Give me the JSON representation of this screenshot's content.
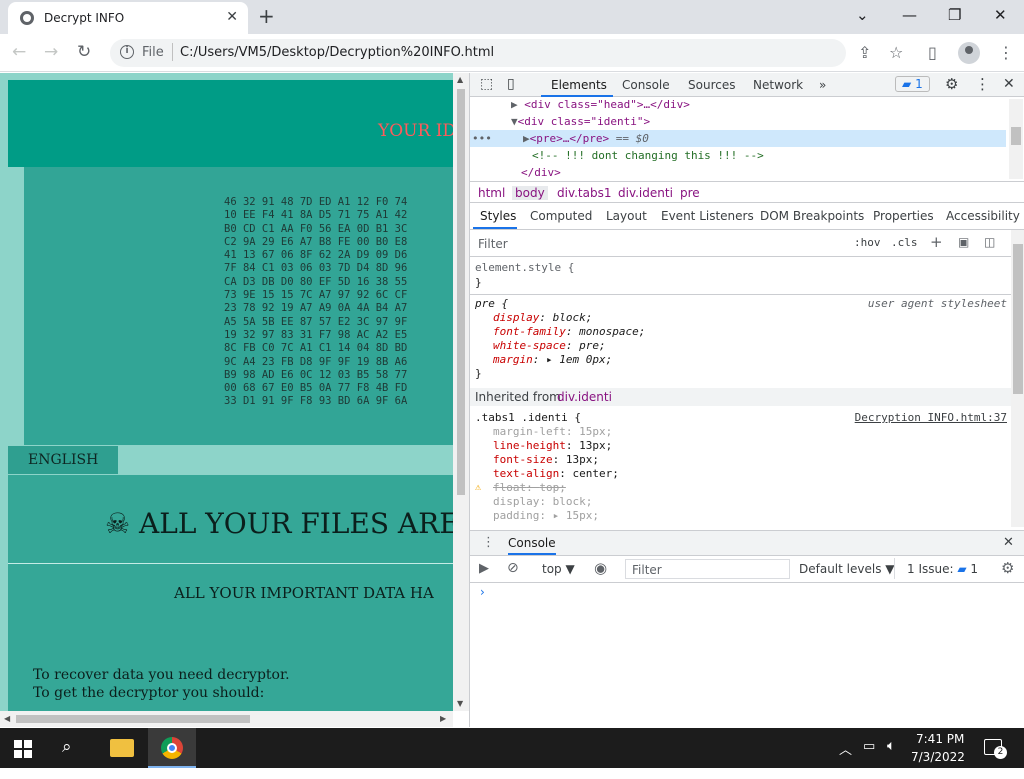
{
  "browser": {
    "tab_title": "Decrypt INFO",
    "new_tab": "+",
    "file_label": "File",
    "url": "C:/Users/VM5/Desktop/Decryption%20INFO.html",
    "controls": {
      "minimize": "⌄",
      "restore": "—",
      "max": "❐",
      "close": "✕"
    }
  },
  "page": {
    "your_id": "YOUR ID",
    "id_lines": [
      "46 32 91 48 7D ED A1 12 F0 74",
      "10 EE F4 41 8A D5 71 75 A1 42",
      "B0 CD C1 AA F0 56 EA 0D B1 3C",
      "C2 9A 29 E6 A7 B8 FE 00 B0 E8",
      "41 13 67 06 8F 62 2A D9 09 D6",
      "7F 84 C1 03 06 03 7D D4 8D 96",
      "CA D3 DB D0 80 EF 5D 16 38 55",
      "73 9E 15 15 7C A7 97 92 6C CF",
      "23 78 92 19 A7 A9 0A 4A B4 A7",
      "A5 5A 5B EE 87 57 E2 3C 97 9F",
      "19 32 97 83 31 F7 98 AC A2 E5",
      "8C FB C0 7C A1 C1 14 04 8D BD",
      "9C A4 23 FB D8 9F 9F 19 8B A6",
      "B9 98 AD E6 0C 12 03 B5 58 77",
      "00 68 67 E0 B5 0A 77 F8 4B FD",
      "33 D1 91 9F F8 93 BD 6A 9F 6A"
    ],
    "english_tab": "ENGLISH",
    "headline": "☠ ALL YOUR FILES ARE",
    "subheadline": "ALL YOUR IMPORTANT DATA HA",
    "recover_line1": "To recover data you need decryptor.",
    "recover_line2": "To get the decryptor you should:"
  },
  "devtools": {
    "tabs": [
      "Elements",
      "Console",
      "Sources",
      "Network",
      "»"
    ],
    "issues_badge": "1",
    "dom": {
      "line1": "<div class=\"head\">…</div>",
      "line2": "<div class=\"identi\">",
      "line3": "<pre>…</pre>",
      "line3_suffix": "== $0",
      "line4": "<!-- !!! dont changing this !!! -->",
      "line5": "</div>"
    },
    "breadcrumbs": [
      "html",
      "body",
      "div.tabs1",
      "div.identi",
      "pre"
    ],
    "style_tabs": [
      "Styles",
      "Computed",
      "Layout",
      "Event Listeners",
      "DOM Breakpoints",
      "Properties",
      "Accessibility"
    ],
    "filter_placeholder": "Filter",
    "hov": ":hov",
    "cls": ".cls",
    "element_style": "element.style {",
    "close_brace": "}",
    "pre_selector": "pre {",
    "user_agent": "user agent stylesheet",
    "pre_props": [
      {
        "name": "display",
        "value": "block;"
      },
      {
        "name": "font-family",
        "value": "monospace;"
      },
      {
        "name": "white-space",
        "value": "pre;"
      },
      {
        "name": "margin",
        "value": "▸ 1em 0px;"
      }
    ],
    "inherited_label": "Inherited from",
    "inherited_from": "div.identi",
    "rule2_selector": ".tabs1 .identi {",
    "rule2_source": "Decryption INFO.html:37",
    "rule2_props": [
      {
        "name": "margin-left",
        "value": "15px;"
      },
      {
        "name": "line-height",
        "value": "13px;"
      },
      {
        "name": "font-size",
        "value": "13px;"
      },
      {
        "name": "text-align",
        "value": "center;"
      },
      {
        "name": "float",
        "value": "top;"
      },
      {
        "name": "display",
        "value": "block;"
      },
      {
        "name": "padding",
        "value": "▸ 15px;"
      }
    ],
    "console_label": "Console",
    "console_context": "top ▼",
    "console_filter": "Filter",
    "default_levels": "Default levels ▼",
    "issues_text": "1 Issue:",
    "issues_count": "1",
    "prompt": "›"
  },
  "taskbar": {
    "time": "7:41 PM",
    "date": "7/3/2022",
    "notif_count": "2"
  }
}
